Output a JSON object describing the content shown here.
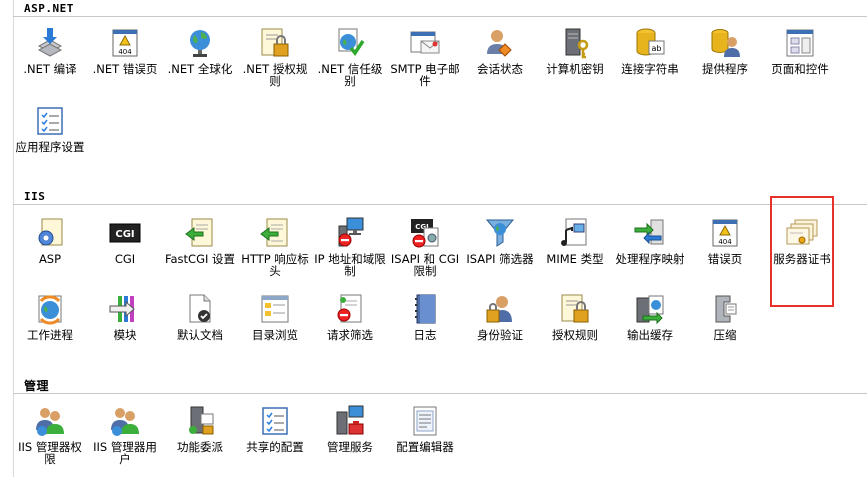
{
  "sections": {
    "aspnet": {
      "title": "ASP.NET"
    },
    "iis": {
      "title": "IIS"
    },
    "manage": {
      "title": "管理"
    }
  },
  "aspnet_items": [
    {
      "label": ".NET 编译",
      "icon": "net-compile-icon"
    },
    {
      "label": ".NET 错误页",
      "icon": "error-page-404-icon"
    },
    {
      "label": ".NET 全球化",
      "icon": "globe-icon"
    },
    {
      "label": ".NET 授权规则",
      "icon": "lock-document-icon"
    },
    {
      "label": ".NET 信任级别",
      "icon": "trust-globe-check-icon"
    },
    {
      "label": "SMTP 电子邮件",
      "icon": "email-icon"
    },
    {
      "label": "会话状态",
      "icon": "session-user-icon"
    },
    {
      "label": "计算机密钥",
      "icon": "server-key-icon"
    },
    {
      "label": "连接字符串",
      "icon": "database-string-icon"
    },
    {
      "label": "提供程序",
      "icon": "provider-user-icon"
    },
    {
      "label": "页面和控件",
      "icon": "page-controls-icon"
    },
    {
      "label": "应用程序设置",
      "icon": "app-settings-icon"
    }
  ],
  "iis_items": [
    {
      "label": "ASP",
      "icon": "asp-gear-document-icon"
    },
    {
      "label": "CGI",
      "icon": "cgi-icon"
    },
    {
      "label": "FastCGI 设置",
      "icon": "fastcgi-icon"
    },
    {
      "label": "HTTP 响应标头",
      "icon": "http-header-icon"
    },
    {
      "label": "IP 地址和域限制",
      "icon": "ip-restriction-icon"
    },
    {
      "label": "ISAPI 和 CGI 限制",
      "icon": "isapi-cgi-restriction-icon"
    },
    {
      "label": "ISAPI 筛选器",
      "icon": "filter-funnel-icon"
    },
    {
      "label": "MIME 类型",
      "icon": "mime-media-icon"
    },
    {
      "label": "处理程序映射",
      "icon": "handler-mapping-icon"
    },
    {
      "label": "错误页",
      "icon": "error-page-404-icon"
    },
    {
      "label": "服务器证书",
      "icon": "certificate-icon"
    },
    {
      "label": "工作进程",
      "icon": "worker-process-icon"
    },
    {
      "label": "模块",
      "icon": "modules-icon"
    },
    {
      "label": "默认文档",
      "icon": "default-document-icon"
    },
    {
      "label": "目录浏览",
      "icon": "directory-browse-icon"
    },
    {
      "label": "请求筛选",
      "icon": "request-filter-icon"
    },
    {
      "label": "日志",
      "icon": "log-notebook-icon"
    },
    {
      "label": "身份验证",
      "icon": "authentication-user-lock-icon"
    },
    {
      "label": "授权规则",
      "icon": "authorization-lock-icon"
    },
    {
      "label": "输出缓存",
      "icon": "output-cache-icon"
    },
    {
      "label": "压缩",
      "icon": "compression-clamp-icon"
    }
  ],
  "manage_items": [
    {
      "label": "IIS 管理器权限",
      "icon": "manager-permissions-icon"
    },
    {
      "label": "IIS 管理器用户",
      "icon": "manager-users-icon"
    },
    {
      "label": "功能委派",
      "icon": "feature-delegation-icon"
    },
    {
      "label": "共享的配置",
      "icon": "shared-config-icon"
    },
    {
      "label": "管理服务",
      "icon": "management-service-icon"
    },
    {
      "label": "配置编辑器",
      "icon": "config-editor-icon"
    }
  ],
  "colors": {
    "highlight": "#e8302a",
    "rule": "#c8c8c8"
  }
}
